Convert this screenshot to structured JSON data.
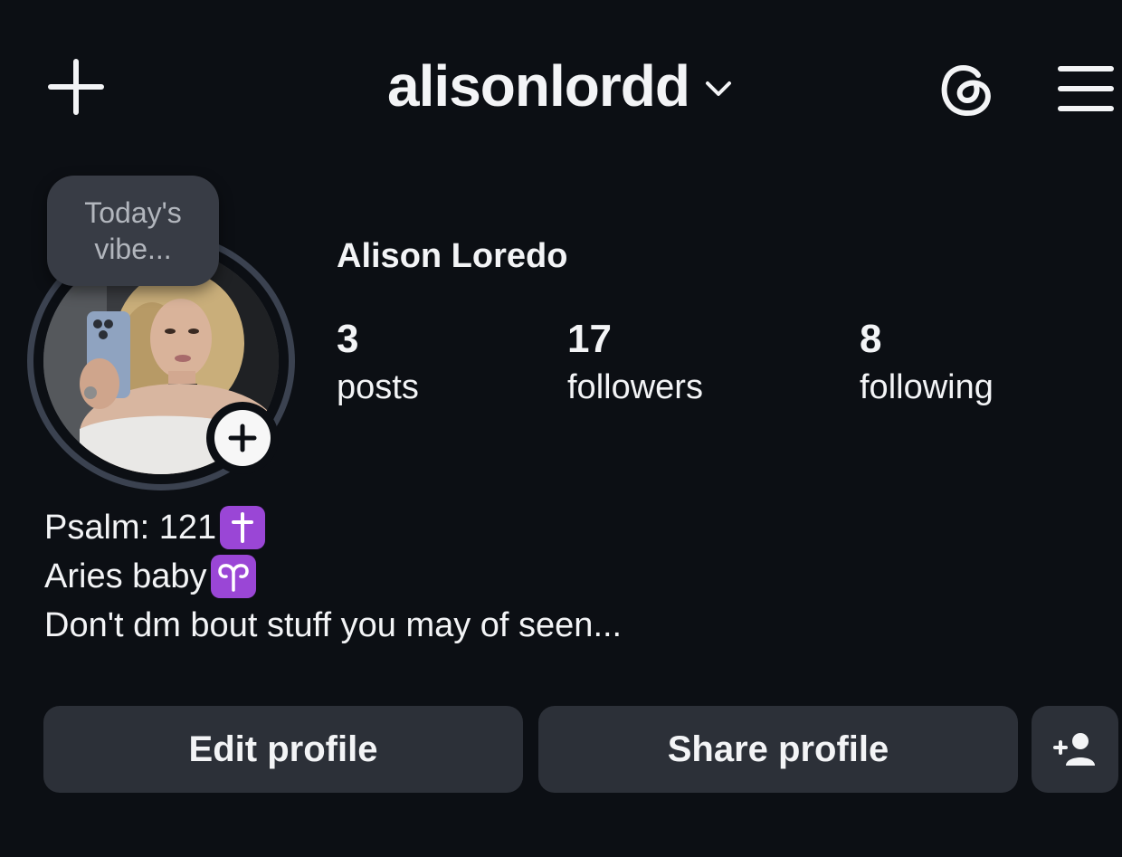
{
  "header": {
    "username": "alisonlordd",
    "icons": [
      "plus-icon",
      "chevron-down-icon",
      "threads-icon",
      "hamburger-menu-icon"
    ]
  },
  "note": {
    "line1": "Today's",
    "line2": "vibe..."
  },
  "profile": {
    "display_name": "Alison Loredo",
    "stats": {
      "posts": {
        "value": "3",
        "label": "posts"
      },
      "followers": {
        "value": "17",
        "label": "followers"
      },
      "following": {
        "value": "8",
        "label": "following"
      }
    }
  },
  "bio": {
    "line1": "Psalm: 121",
    "line1_emoji": "✝",
    "line2": "Aries baby",
    "line2_emoji": "♈",
    "line3": "Don't dm bout stuff you may of seen..."
  },
  "buttons": {
    "edit": "Edit profile",
    "share": "Share profile"
  },
  "colors": {
    "background": "#0c0f14",
    "button_bg": "#2c3038",
    "emoji_purple": "#9a46d6",
    "ring": "#3b4250"
  }
}
